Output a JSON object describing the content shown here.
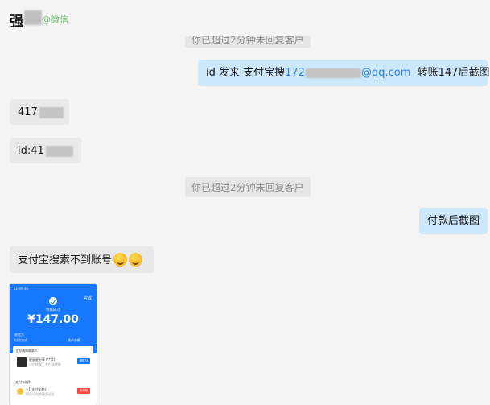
{
  "header": {
    "contact_name": "强",
    "subtitle": "@微信"
  },
  "messages": [
    {
      "type": "system",
      "text": "你已超过2分钟未回复客户"
    },
    {
      "type": "outgoing",
      "prefix": "id  发来   支付宝搜",
      "email_start": "172",
      "email_end": "@qq.com",
      "suffix": "转账147后截图"
    },
    {
      "type": "incoming",
      "text": "417"
    },
    {
      "type": "incoming",
      "text": "id:41"
    },
    {
      "type": "system",
      "text": "你已超过2分钟未回复客户"
    },
    {
      "type": "outgoing",
      "text": "付款后截图"
    },
    {
      "type": "incoming",
      "text": "支付宝搜索不到账号",
      "emojis": [
        "crying-laughing-emoji",
        "crying-laughing-emoji"
      ]
    }
  ],
  "screenshot": {
    "status_time": "22:09 4G",
    "done_label": "完成",
    "status_text": "转账成功",
    "amount": "¥147.00",
    "row1_label": "收款方",
    "row2_label": "付款方式",
    "row2_value": "账户余额",
    "card1_title": "立即通知收款人",
    "card1_name": "星辰星分享 (**华)",
    "card1_sub": "以后找我，支付宝转账",
    "card1_button": "通知TA",
    "card2_title": "支付有福利",
    "card2_item": "+1 支付宝积分",
    "card2_sub": "积分可兑换更多好礼",
    "card2_button": "去领取",
    "colors": {
      "primary": "#1677ff",
      "button_red": "#f5463d"
    }
  }
}
